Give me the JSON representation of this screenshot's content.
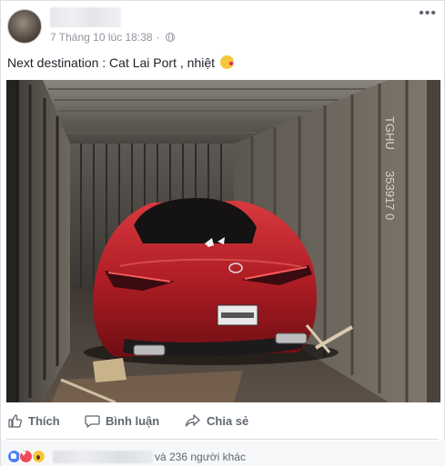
{
  "post": {
    "author_blurred": true,
    "timestamp": "7 Tháng 10 lúc 18:38",
    "separator": "·",
    "privacy_icon": "globe-icon",
    "more_label": "•••",
    "caption": "Next destination : Cat Lai Port , nhiệt",
    "caption_emoji": "kiss-emoji",
    "photo_container_code_1": "TGHU",
    "photo_container_code_2": "353917 0"
  },
  "actions": {
    "like_label": "Thích",
    "comment_label": "Bình luận",
    "share_label": "Chia sẻ"
  },
  "reactions": {
    "icons": [
      "like-reaction-icon",
      "love-reaction-icon",
      "wow-reaction-icon"
    ],
    "others_text": "và 236 người khác"
  },
  "colors": {
    "meta_text": "#90949c",
    "action_text": "#606770",
    "like_blue": "#4f7ff4",
    "love_red": "#f04b5d",
    "wow_yellow": "#f7c53b",
    "car_red": "#b01d25"
  }
}
